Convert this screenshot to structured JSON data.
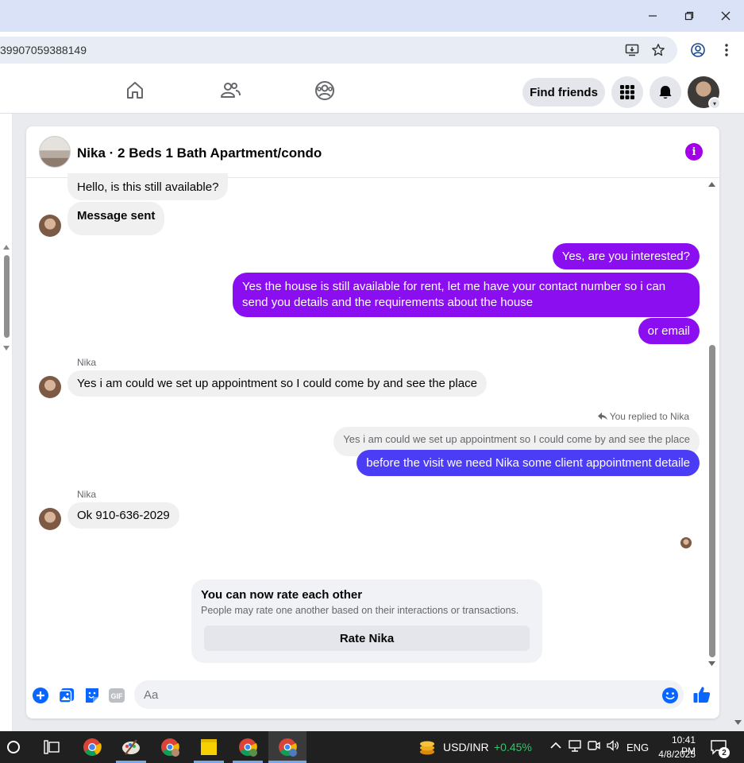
{
  "browser": {
    "url_fragment": "39907059388149",
    "window_controls": [
      "minimize",
      "restore",
      "close"
    ]
  },
  "fbnav": {
    "find_friends_label": "Find friends"
  },
  "chat": {
    "title": "Nika · 2 Beds 1 Bath Apartment/condo",
    "messages": [
      {
        "from": "them",
        "text": "Hello, is this still available?"
      },
      {
        "from": "them",
        "text": "Message sent"
      },
      {
        "from": "me",
        "text": "Yes, are you interested?"
      },
      {
        "from": "me",
        "text": "Yes the house is still available for rent, let me have your contact number so i can send you details and the requirements about the house"
      },
      {
        "from": "me",
        "text": "or email"
      },
      {
        "from": "them",
        "sender": "Nika",
        "text": "Yes i am could we set up appointment so I could come by and see the place"
      },
      {
        "from": "me",
        "replied_label": "You replied to Nika",
        "quoted": "Yes i am could we set up appointment so I could come by and see the place",
        "text": "before the visit we need Nika  some client appointment detaile"
      },
      {
        "from": "them",
        "sender": "Nika",
        "text": "Ok 910-636-2029"
      }
    ],
    "rate_card": {
      "title": "You can now rate each other",
      "subtitle": "People may rate one another based on their interactions or transactions.",
      "button_label": "Rate Nika"
    },
    "composer": {
      "placeholder": "Aa"
    },
    "accent_color": "#8a0ef0",
    "reply_color": "#4b3cf5"
  },
  "taskbar": {
    "currency_label": "USD/INR",
    "currency_change": "+0.45%",
    "language": "ENG",
    "time": "10:41 PM",
    "date": "4/8/2025",
    "notification_count": "2"
  }
}
